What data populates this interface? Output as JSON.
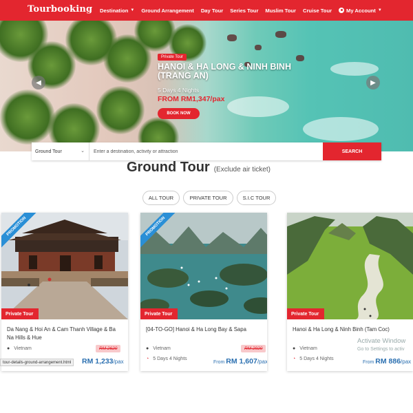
{
  "nav": {
    "logo": "Tourbooking",
    "links": [
      {
        "label": "Destination",
        "dropdown": true
      },
      {
        "label": "Ground Arrangement",
        "dropdown": false
      },
      {
        "label": "Day Tour",
        "dropdown": false
      },
      {
        "label": "Series Tour",
        "dropdown": false
      },
      {
        "label": "Muslim Tour",
        "dropdown": false
      },
      {
        "label": "Cruise Tour",
        "dropdown": false
      }
    ],
    "account": "My Account",
    "color": "#e3262f"
  },
  "hero": {
    "badge": "Private Tour",
    "title": "HANOI & HA LONG & NINH BINH (TRANG AN)",
    "subtitle": "5 Days 4 Nights",
    "price": "FROM RM1,347/pax",
    "button": "BOOK NOW",
    "prev_icon": "chevron-left-icon",
    "next_icon": "chevron-right-icon"
  },
  "search": {
    "category": "Ground Tour",
    "placeholder": "Enter a destination, activity or attraction",
    "button": "SEARCH"
  },
  "section": {
    "title": "Ground Tour",
    "subtitle": "(Exclude air ticket)"
  },
  "filters": [
    "ALL TOUR",
    "PRIVATE TOUR",
    "S.I.C TOUR"
  ],
  "cards": [
    {
      "ribbon": "PROMOTION",
      "tag": "Private Tour",
      "title": "Da Nang & Hoi An & Cam Thanh Village & Ba Na Hills & Hue",
      "location": "Vietnam",
      "duration": "",
      "old_price": "RM 2620",
      "price_prefix": "",
      "price": "RM 1,233",
      "price_unit": "/pax"
    },
    {
      "ribbon": "PROMOTION",
      "tag": "Private Tour",
      "title": "[04-TO-GO] Hanoi & Ha Long Bay & Sapa",
      "location": "Vietnam",
      "duration": "5 Days 4 Nights",
      "old_price": "RM 2920",
      "price_prefix": "From ",
      "price": "RM 1,607",
      "price_unit": "/pax"
    },
    {
      "ribbon": "",
      "tag": "Private Tour",
      "title": "Hanoi & Ha Long & Ninh Binh (Tam Coc)",
      "location": "Vietnam",
      "duration": "5 Days 4 Nights",
      "old_price": "",
      "price_prefix": "From ",
      "price": "RM 886",
      "price_unit": "/pax"
    }
  ],
  "status_url": "tour-details-ground-arrangement.html",
  "watermark": {
    "title": "Activate Window",
    "sub": "Go to Settings to activ"
  }
}
